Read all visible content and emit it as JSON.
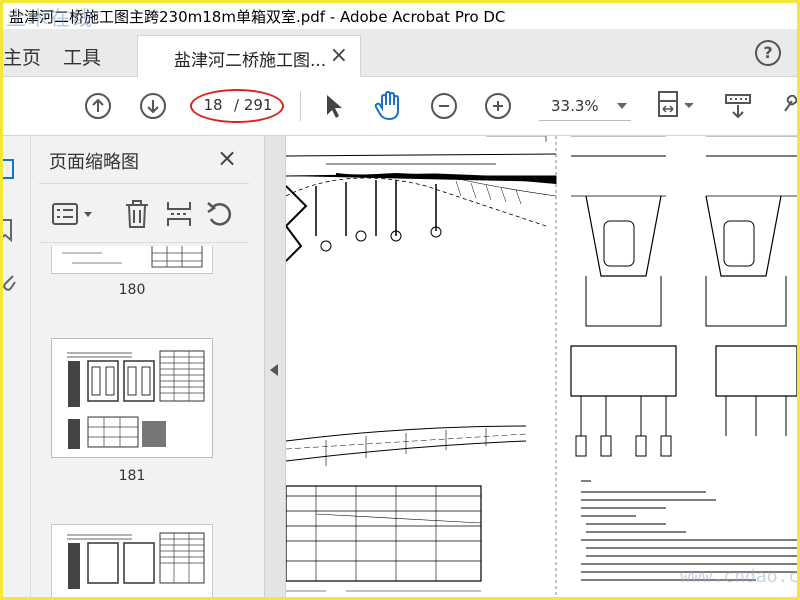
{
  "window": {
    "title": "盐津河二桥施工图主跨230m18m单箱双室.pdf - Adobe Acrobat Pro DC",
    "watermark_logo": "土木在线",
    "watermark_site": "www.cndao.com"
  },
  "tabs": {
    "home": "主页",
    "tools": "工具",
    "document_tab": "盐津河二桥施工图...",
    "close_symbol": "×",
    "help_symbol": "?"
  },
  "toolbar": {
    "current_page": "18",
    "total_pages": "/ 291",
    "zoom": "33.3%",
    "icons": [
      "arrow-up-icon",
      "arrow-down-icon",
      "select-pointer-icon",
      "hand-tool-icon",
      "zoom-out-icon",
      "zoom-in-icon",
      "page-fit-icon",
      "scroll-mode-icon",
      "keyboard-icon",
      "link-icon"
    ],
    "annotation_color": "#d9231f"
  },
  "thumbnails_panel": {
    "title": "页面缩略图",
    "close_symbol": "×",
    "tools": [
      "thumbnail-options-icon",
      "delete-icon",
      "insert-page-icon",
      "rotate-icon"
    ],
    "pages": [
      {
        "label": "180"
      },
      {
        "label": "181"
      },
      {
        "label": ""
      }
    ]
  },
  "colors": {
    "frame": "#f5e63a",
    "chrome": "#eaeaea",
    "panel": "#f2f2f2",
    "hand_tool": "#1a73c9"
  }
}
